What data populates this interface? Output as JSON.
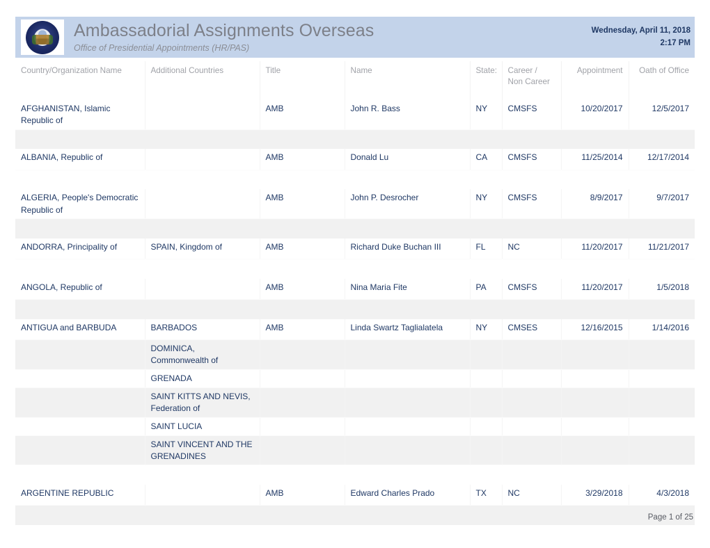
{
  "header": {
    "seal_icon": "us-department-of-state-seal-icon",
    "title": "Ambassadorial Assignments Overseas",
    "subtitle": "Office of Presidential Appointments (HR/PAS)",
    "date": "Wednesday, April 11, 2018",
    "time": "2:17 PM",
    "banner_color": "#c3d3ea",
    "title_color": "#7d8089",
    "stamp_color": "#1f3864"
  },
  "table": {
    "columns": [
      {
        "label": "Country/Organization Name",
        "align": "left"
      },
      {
        "label": "Additional Countries",
        "align": "left"
      },
      {
        "label": "Title",
        "align": "left"
      },
      {
        "label": "Name",
        "align": "left"
      },
      {
        "label": "State:",
        "align": "left"
      },
      {
        "label": "Career /\nNon Career",
        "align": "left"
      },
      {
        "label": "Appointment",
        "align": "right"
      },
      {
        "label": "Oath of  Office",
        "align": "right"
      }
    ],
    "column_labels": {
      "country": "Country/Organization Name",
      "additional": "Additional Countries",
      "title": "Title",
      "name": "Name",
      "state": "State:",
      "career_line1": "Career /",
      "career_line2": "Non Career",
      "appointment": "Appointment",
      "oath": "Oath of  Office"
    },
    "rows": [
      {
        "country": "AFGHANISTAN, Islamic Republic of",
        "additional": "",
        "title": "AMB",
        "name": "John R. Bass",
        "state": "NY",
        "career": "CMSFS",
        "appointment": "10/20/2017",
        "oath": "12/5/2017",
        "extra_countries": []
      },
      {
        "country": "ALBANIA, Republic of",
        "additional": "",
        "title": "AMB",
        "name": "Donald  Lu",
        "state": "CA",
        "career": "CMSFS",
        "appointment": "11/25/2014",
        "oath": "12/17/2014",
        "extra_countries": []
      },
      {
        "country": "ALGERIA, People's Democratic Republic of",
        "additional": "",
        "title": "AMB",
        "name": "John P. Desrocher",
        "state": "NY",
        "career": "CMSFS",
        "appointment": "8/9/2017",
        "oath": "9/7/2017",
        "extra_countries": []
      },
      {
        "country": "ANDORRA, Principality of",
        "additional": "SPAIN, Kingdom of",
        "title": "AMB",
        "name": "Richard Duke Buchan III",
        "state": "FL",
        "career": "NC",
        "appointment": "11/20/2017",
        "oath": "11/21/2017",
        "extra_countries": []
      },
      {
        "country": "ANGOLA, Republic of",
        "additional": "",
        "title": "AMB",
        "name": "Nina Maria Fite",
        "state": "PA",
        "career": "CMSFS",
        "appointment": "11/20/2017",
        "oath": "1/5/2018",
        "extra_countries": []
      },
      {
        "country": "ANTIGUA and BARBUDA",
        "additional": "BARBADOS",
        "title": "AMB",
        "name": "Linda Swartz Taglialatela",
        "state": "NY",
        "career": "CMSES",
        "appointment": "12/16/2015",
        "oath": "1/14/2016",
        "extra_countries": [
          "DOMINICA, Commonwealth of",
          "GRENADA",
          "SAINT KITTS AND NEVIS, Federation of",
          "SAINT LUCIA",
          "SAINT VINCENT AND THE GRENADINES"
        ]
      },
      {
        "country": "ARGENTINE REPUBLIC",
        "additional": "",
        "title": "AMB",
        "name": "Edward Charles Prado",
        "state": "TX",
        "career": "NC",
        "appointment": "3/29/2018",
        "oath": "4/3/2018",
        "extra_countries": []
      }
    ]
  },
  "footer": {
    "page_label": "Page 1 of 25"
  }
}
